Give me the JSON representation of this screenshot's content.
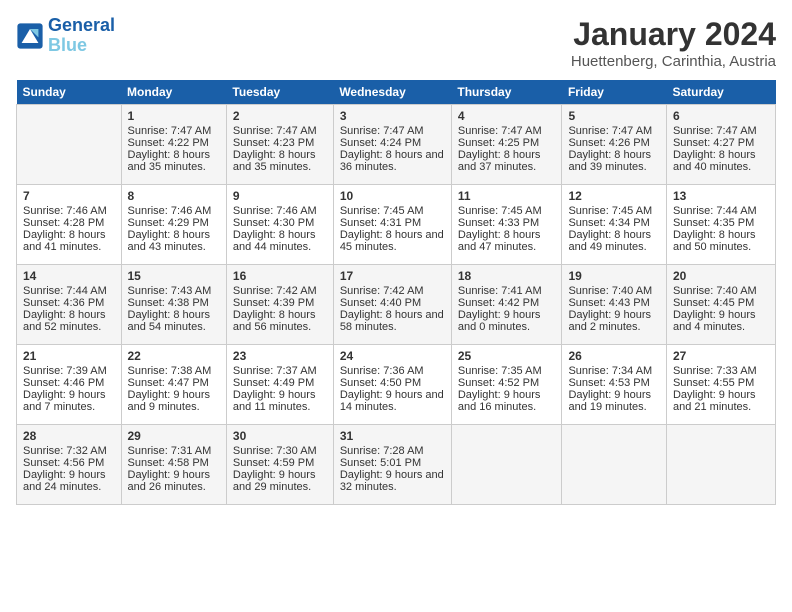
{
  "header": {
    "logo_line1": "General",
    "logo_line2": "Blue",
    "month_year": "January 2024",
    "location": "Huettenberg, Carinthia, Austria"
  },
  "weekdays": [
    "Sunday",
    "Monday",
    "Tuesday",
    "Wednesday",
    "Thursday",
    "Friday",
    "Saturday"
  ],
  "weeks": [
    [
      {
        "day": "",
        "sunrise": "",
        "sunset": "",
        "daylight": ""
      },
      {
        "day": "1",
        "sunrise": "Sunrise: 7:47 AM",
        "sunset": "Sunset: 4:22 PM",
        "daylight": "Daylight: 8 hours and 35 minutes."
      },
      {
        "day": "2",
        "sunrise": "Sunrise: 7:47 AM",
        "sunset": "Sunset: 4:23 PM",
        "daylight": "Daylight: 8 hours and 35 minutes."
      },
      {
        "day": "3",
        "sunrise": "Sunrise: 7:47 AM",
        "sunset": "Sunset: 4:24 PM",
        "daylight": "Daylight: 8 hours and 36 minutes."
      },
      {
        "day": "4",
        "sunrise": "Sunrise: 7:47 AM",
        "sunset": "Sunset: 4:25 PM",
        "daylight": "Daylight: 8 hours and 37 minutes."
      },
      {
        "day": "5",
        "sunrise": "Sunrise: 7:47 AM",
        "sunset": "Sunset: 4:26 PM",
        "daylight": "Daylight: 8 hours and 39 minutes."
      },
      {
        "day": "6",
        "sunrise": "Sunrise: 7:47 AM",
        "sunset": "Sunset: 4:27 PM",
        "daylight": "Daylight: 8 hours and 40 minutes."
      }
    ],
    [
      {
        "day": "7",
        "sunrise": "Sunrise: 7:46 AM",
        "sunset": "Sunset: 4:28 PM",
        "daylight": "Daylight: 8 hours and 41 minutes."
      },
      {
        "day": "8",
        "sunrise": "Sunrise: 7:46 AM",
        "sunset": "Sunset: 4:29 PM",
        "daylight": "Daylight: 8 hours and 43 minutes."
      },
      {
        "day": "9",
        "sunrise": "Sunrise: 7:46 AM",
        "sunset": "Sunset: 4:30 PM",
        "daylight": "Daylight: 8 hours and 44 minutes."
      },
      {
        "day": "10",
        "sunrise": "Sunrise: 7:45 AM",
        "sunset": "Sunset: 4:31 PM",
        "daylight": "Daylight: 8 hours and 45 minutes."
      },
      {
        "day": "11",
        "sunrise": "Sunrise: 7:45 AM",
        "sunset": "Sunset: 4:33 PM",
        "daylight": "Daylight: 8 hours and 47 minutes."
      },
      {
        "day": "12",
        "sunrise": "Sunrise: 7:45 AM",
        "sunset": "Sunset: 4:34 PM",
        "daylight": "Daylight: 8 hours and 49 minutes."
      },
      {
        "day": "13",
        "sunrise": "Sunrise: 7:44 AM",
        "sunset": "Sunset: 4:35 PM",
        "daylight": "Daylight: 8 hours and 50 minutes."
      }
    ],
    [
      {
        "day": "14",
        "sunrise": "Sunrise: 7:44 AM",
        "sunset": "Sunset: 4:36 PM",
        "daylight": "Daylight: 8 hours and 52 minutes."
      },
      {
        "day": "15",
        "sunrise": "Sunrise: 7:43 AM",
        "sunset": "Sunset: 4:38 PM",
        "daylight": "Daylight: 8 hours and 54 minutes."
      },
      {
        "day": "16",
        "sunrise": "Sunrise: 7:42 AM",
        "sunset": "Sunset: 4:39 PM",
        "daylight": "Daylight: 8 hours and 56 minutes."
      },
      {
        "day": "17",
        "sunrise": "Sunrise: 7:42 AM",
        "sunset": "Sunset: 4:40 PM",
        "daylight": "Daylight: 8 hours and 58 minutes."
      },
      {
        "day": "18",
        "sunrise": "Sunrise: 7:41 AM",
        "sunset": "Sunset: 4:42 PM",
        "daylight": "Daylight: 9 hours and 0 minutes."
      },
      {
        "day": "19",
        "sunrise": "Sunrise: 7:40 AM",
        "sunset": "Sunset: 4:43 PM",
        "daylight": "Daylight: 9 hours and 2 minutes."
      },
      {
        "day": "20",
        "sunrise": "Sunrise: 7:40 AM",
        "sunset": "Sunset: 4:45 PM",
        "daylight": "Daylight: 9 hours and 4 minutes."
      }
    ],
    [
      {
        "day": "21",
        "sunrise": "Sunrise: 7:39 AM",
        "sunset": "Sunset: 4:46 PM",
        "daylight": "Daylight: 9 hours and 7 minutes."
      },
      {
        "day": "22",
        "sunrise": "Sunrise: 7:38 AM",
        "sunset": "Sunset: 4:47 PM",
        "daylight": "Daylight: 9 hours and 9 minutes."
      },
      {
        "day": "23",
        "sunrise": "Sunrise: 7:37 AM",
        "sunset": "Sunset: 4:49 PM",
        "daylight": "Daylight: 9 hours and 11 minutes."
      },
      {
        "day": "24",
        "sunrise": "Sunrise: 7:36 AM",
        "sunset": "Sunset: 4:50 PM",
        "daylight": "Daylight: 9 hours and 14 minutes."
      },
      {
        "day": "25",
        "sunrise": "Sunrise: 7:35 AM",
        "sunset": "Sunset: 4:52 PM",
        "daylight": "Daylight: 9 hours and 16 minutes."
      },
      {
        "day": "26",
        "sunrise": "Sunrise: 7:34 AM",
        "sunset": "Sunset: 4:53 PM",
        "daylight": "Daylight: 9 hours and 19 minutes."
      },
      {
        "day": "27",
        "sunrise": "Sunrise: 7:33 AM",
        "sunset": "Sunset: 4:55 PM",
        "daylight": "Daylight: 9 hours and 21 minutes."
      }
    ],
    [
      {
        "day": "28",
        "sunrise": "Sunrise: 7:32 AM",
        "sunset": "Sunset: 4:56 PM",
        "daylight": "Daylight: 9 hours and 24 minutes."
      },
      {
        "day": "29",
        "sunrise": "Sunrise: 7:31 AM",
        "sunset": "Sunset: 4:58 PM",
        "daylight": "Daylight: 9 hours and 26 minutes."
      },
      {
        "day": "30",
        "sunrise": "Sunrise: 7:30 AM",
        "sunset": "Sunset: 4:59 PM",
        "daylight": "Daylight: 9 hours and 29 minutes."
      },
      {
        "day": "31",
        "sunrise": "Sunrise: 7:28 AM",
        "sunset": "Sunset: 5:01 PM",
        "daylight": "Daylight: 9 hours and 32 minutes."
      },
      {
        "day": "",
        "sunrise": "",
        "sunset": "",
        "daylight": ""
      },
      {
        "day": "",
        "sunrise": "",
        "sunset": "",
        "daylight": ""
      },
      {
        "day": "",
        "sunrise": "",
        "sunset": "",
        "daylight": ""
      }
    ]
  ]
}
